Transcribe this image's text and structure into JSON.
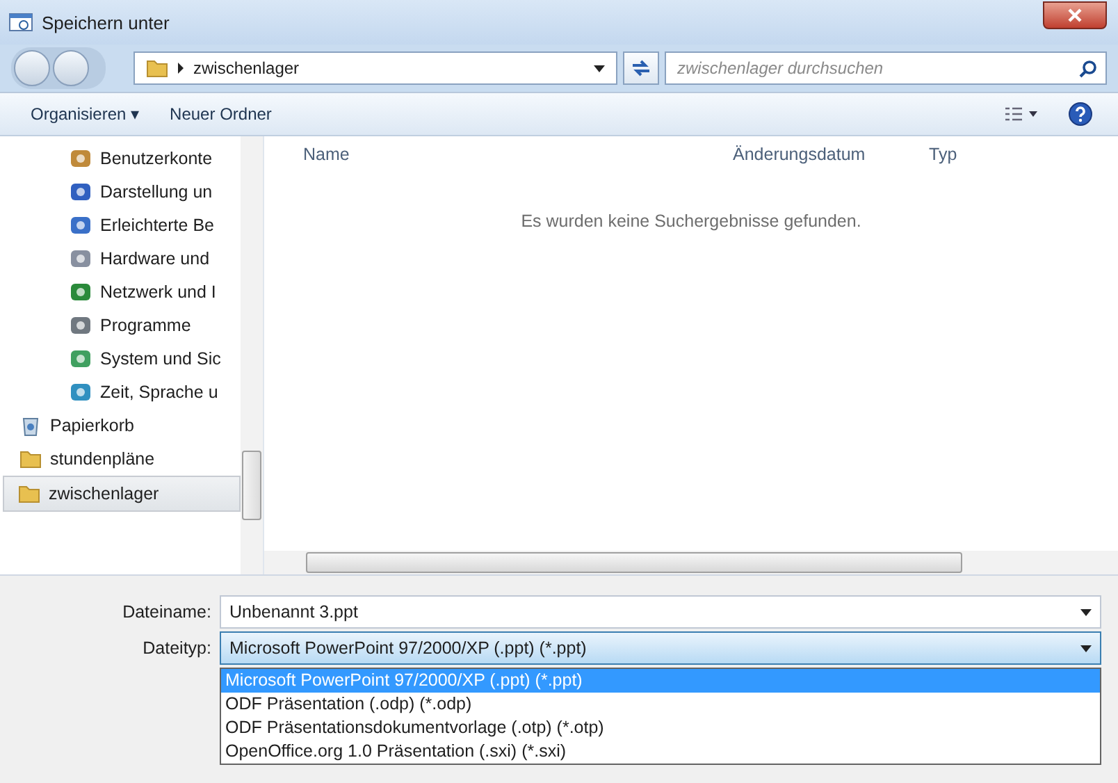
{
  "window": {
    "title": "Speichern unter"
  },
  "address_bar": {
    "path": "zwischenlager",
    "search_placeholder": "zwischenlager durchsuchen"
  },
  "toolbar": {
    "organize": "Organisieren ▾",
    "new_folder": "Neuer Ordner"
  },
  "nav_pane": {
    "control_panel_items": [
      {
        "label": "Benutzerkonte",
        "kind": "users"
      },
      {
        "label": "Darstellung un",
        "kind": "display"
      },
      {
        "label": "Erleichterte Be",
        "kind": "access"
      },
      {
        "label": "Hardware und",
        "kind": "hardware"
      },
      {
        "label": "Netzwerk und I",
        "kind": "network"
      },
      {
        "label": "Programme",
        "kind": "programs"
      },
      {
        "label": "System und Sic",
        "kind": "system"
      },
      {
        "label": "Zeit, Sprache u",
        "kind": "clock"
      }
    ],
    "items": [
      {
        "label": "Papierkorb",
        "kind": "trash",
        "selected": false
      },
      {
        "label": "stundenpläne",
        "kind": "folder",
        "selected": false
      },
      {
        "label": "zwischenlager",
        "kind": "folder",
        "selected": true
      }
    ]
  },
  "file_list": {
    "columns": [
      "Name",
      "Änderungsdatum",
      "Typ"
    ],
    "empty_message": "Es wurden keine Suchergebnisse gefunden."
  },
  "save_form": {
    "filename_label": "Dateiname:",
    "filename": "Unbenannt 3.ppt",
    "filetype_label": "Dateityp:",
    "filetype": "Microsoft PowerPoint 97/2000/XP (.ppt) (*.ppt)",
    "filetype_options": [
      {
        "label": "Microsoft PowerPoint 97/2000/XP (.ppt) (*.ppt)",
        "selected": true
      },
      {
        "label": "ODF Präsentation (.odp) (*.odp)",
        "selected": false
      },
      {
        "label": "ODF Präsentationsdokumentvorlage (.otp) (*.otp)",
        "selected": false
      },
      {
        "label": "OpenOffice.org 1.0 Präsentation (.sxi) (*.sxi)",
        "selected": false
      }
    ]
  }
}
